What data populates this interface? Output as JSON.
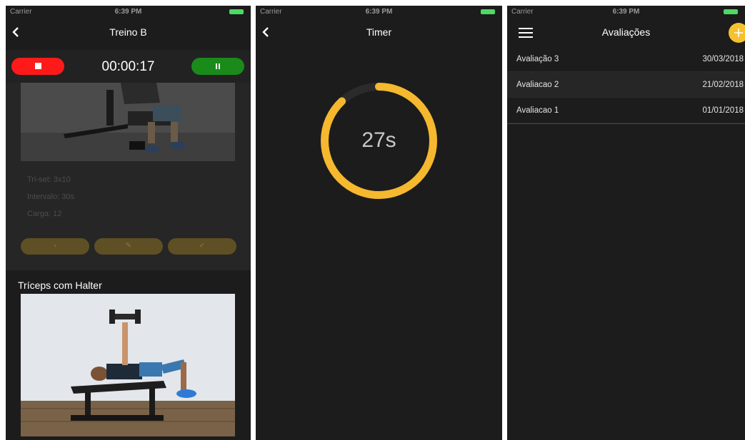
{
  "status": {
    "carrier": "Carrier",
    "time": "6:39 PM"
  },
  "workout": {
    "title": "Treino B",
    "elapsed": "00:00:17",
    "info": [
      "Tri-set: 3x10",
      "Intervalo: 30s",
      "Carga: 12"
    ],
    "next_exercise": "Tríceps com Halter"
  },
  "timer": {
    "title": "Timer",
    "remaining": "27s",
    "progress": 0.88
  },
  "assessments": {
    "title": "Avaliações",
    "items": [
      {
        "name": "Avaliação 3",
        "date": "30/03/2018"
      },
      {
        "name": "Avaliacao 2",
        "date": "21/02/2018"
      },
      {
        "name": "Avaliacao 1",
        "date": "01/01/2018"
      }
    ]
  },
  "colors": {
    "accent": "#f5c12e",
    "stop": "#ff1a1a",
    "pause": "#1a8a1a",
    "background": "#1c1c1c"
  },
  "icons": [
    "back-icon",
    "stop-icon",
    "pause-icon",
    "menu-icon",
    "plus-icon"
  ]
}
